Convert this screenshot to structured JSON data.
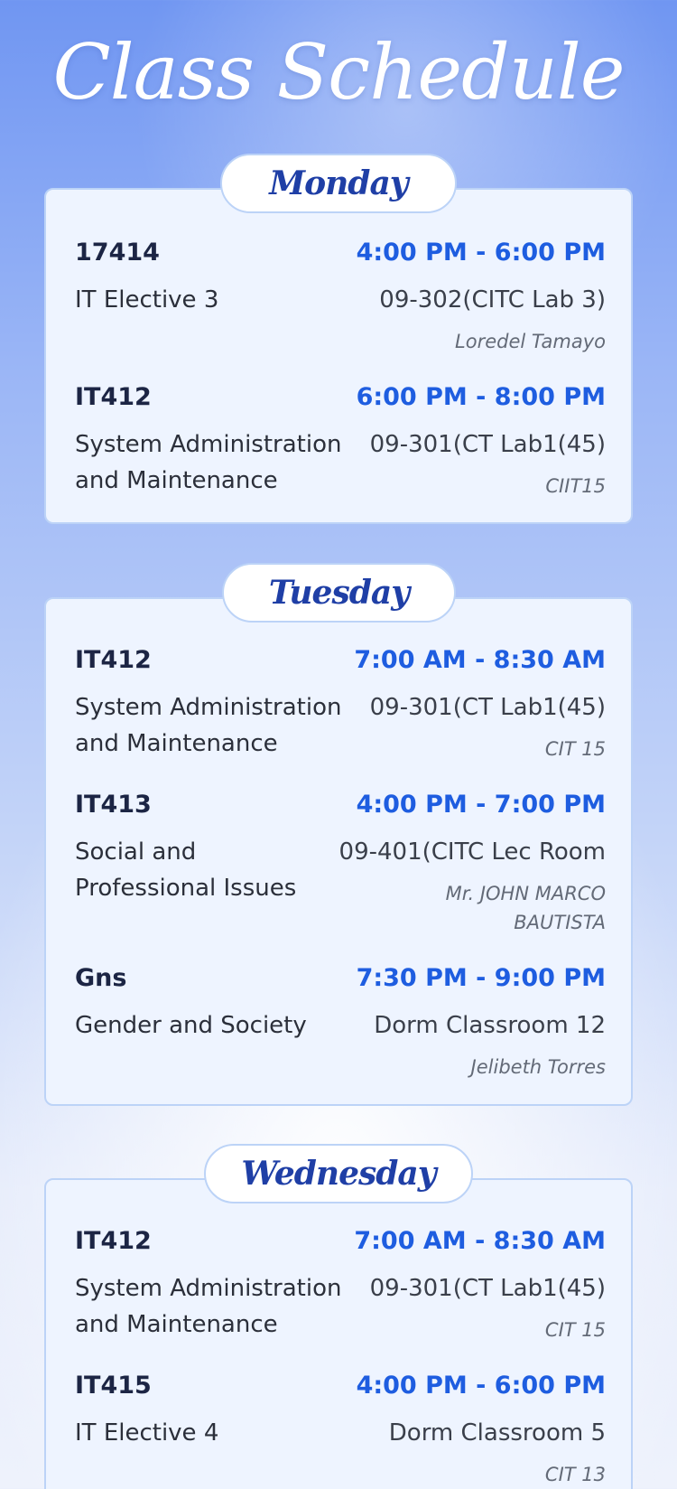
{
  "page": {
    "title": "Class Schedule"
  },
  "days": [
    {
      "name": "Monday",
      "classes": [
        {
          "code": "17414",
          "time": "4:00 PM - 6:00 PM",
          "subject": "IT Elective 3",
          "room": "09-302(CITC Lab 3)",
          "instructor": "Loredel Tamayo"
        },
        {
          "code": "IT412",
          "time": "6:00 PM - 8:00 PM",
          "subject": "System Administration and Maintenance",
          "room": "09-301(CT Lab1(45)",
          "instructor": "CIIT15"
        }
      ]
    },
    {
      "name": "Tuesday",
      "classes": [
        {
          "code": "IT412",
          "time": "7:00 AM - 8:30 AM",
          "subject": "System Administration and Maintenance",
          "room": "09-301(CT Lab1(45)",
          "instructor": "CIT 15"
        },
        {
          "code": "IT413",
          "time": "4:00 PM - 7:00 PM",
          "subject": "Social and Professional Issues",
          "room": "09-401(CITC Lec Room",
          "instructor": "Mr. JOHN MARCO BAUTISTA"
        },
        {
          "code": "Gns",
          "time": "7:30 PM - 9:00 PM",
          "subject": "Gender and Society",
          "room": "Dorm Classroom 12",
          "instructor": "Jelibeth Torres"
        }
      ]
    },
    {
      "name": "Wednesday",
      "classes": [
        {
          "code": "IT412",
          "time": "7:00 AM - 8:30 AM",
          "subject": "System Administration and Maintenance",
          "room": "09-301(CT Lab1(45)",
          "instructor": "CIT 15"
        },
        {
          "code": "IT415",
          "time": "4:00 PM - 6:00 PM",
          "subject": "IT Elective 4",
          "room": "Dorm Classroom 5",
          "instructor": "CIT 13"
        }
      ]
    }
  ]
}
